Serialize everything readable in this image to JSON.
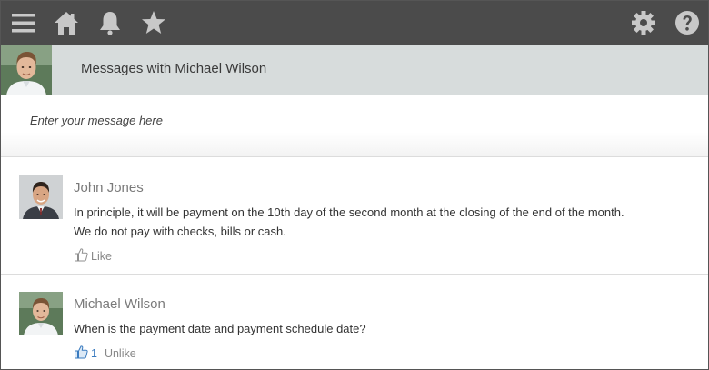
{
  "topbar": {
    "icons": [
      "menu-icon",
      "home-icon",
      "bell-icon",
      "star-icon",
      "gear-icon",
      "help-icon"
    ],
    "icon_color": "#c8c8c8",
    "background": "#4b4b4b"
  },
  "conversation": {
    "title": "Messages with Michael Wilson",
    "header_bg": "#d7dcdc"
  },
  "composer": {
    "placeholder": "Enter your message here"
  },
  "posts": [
    {
      "author": "John Jones",
      "lines": [
        "In principle, it will be payment on the 10th day of the second month at the closing of the end of the month.",
        "We do not pay with checks, bills or cash."
      ],
      "action_label": "Like"
    },
    {
      "author": "Michael Wilson",
      "lines": [
        "When is the payment date and payment schedule date?"
      ],
      "like_count": "1",
      "action_label": "Unlike",
      "liked_color": "#3a7bbf"
    }
  ]
}
